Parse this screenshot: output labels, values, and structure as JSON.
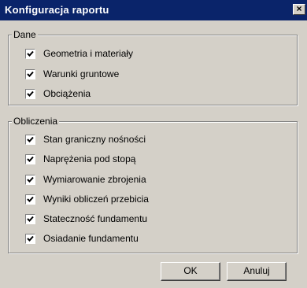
{
  "window": {
    "title": "Konfiguracja raportu",
    "close_glyph": "✕"
  },
  "group_dane": {
    "label": "Dane",
    "items": [
      {
        "label": "Geometria i materiały",
        "checked": true
      },
      {
        "label": "Warunki gruntowe",
        "checked": true
      },
      {
        "label": "Obciążenia",
        "checked": true
      }
    ]
  },
  "group_obliczenia": {
    "label": "Obliczenia",
    "items": [
      {
        "label": "Stan graniczny nośności",
        "checked": true
      },
      {
        "label": "Naprężenia pod stopą",
        "checked": true
      },
      {
        "label": "Wymiarowanie zbrojenia",
        "checked": true
      },
      {
        "label": "Wyniki obliczeń przebicia",
        "checked": true
      },
      {
        "label": "Stateczność fundamentu",
        "checked": true
      },
      {
        "label": "Osiadanie fundamentu",
        "checked": true
      }
    ]
  },
  "buttons": {
    "ok": "OK",
    "cancel": "Anuluj"
  }
}
